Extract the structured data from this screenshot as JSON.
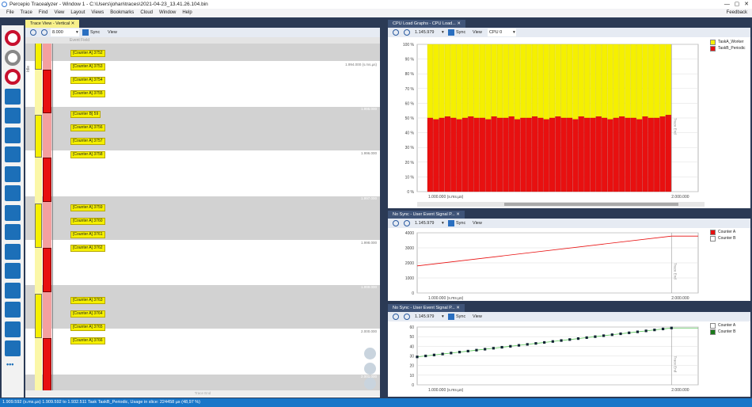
{
  "window": {
    "title": "Percepio Tracealyzer - Window 1 - C:\\Users\\johan\\traces\\2021-04-23_13.41.26.104.bin",
    "feedback": "Feedback"
  },
  "menu": [
    "File",
    "Trace",
    "Find",
    "View",
    "Layout",
    "Views",
    "Bookmarks",
    "Cloud",
    "Window",
    "Help"
  ],
  "sidebar": {
    "items": [
      "record",
      "stop",
      "snapshot",
      "overview",
      "trace",
      "cpu",
      "events",
      "actor",
      "kernel",
      "comm",
      "events-list",
      "signal",
      "flow",
      "memory",
      "user",
      "cpu-2",
      "cpu-3"
    ],
    "more": "•••"
  },
  "trace_view": {
    "tab": "Trace View - Vertical",
    "zoom": "8.000",
    "sync": "Sync",
    "view": "View",
    "event_field": "Event Field",
    "time_labels": [
      "1.994.000 (s.ms.µs)",
      "1.995.000",
      "1.996.000",
      "1.997.000",
      "1.998.000",
      "1.999.000",
      "2.000.000",
      "2.001.000"
    ],
    "events": [
      "[Counter A] 3752",
      "[Counter A] 3753",
      "[Counter A] 3754",
      "[Counter A] 3755",
      "[Counter B] 59",
      "[Counter A] 3756",
      "[Counter A] 3757",
      "[Counter A] 3758",
      "[Counter A] 3759",
      "[Counter A] 3760",
      "[Counter A] 3761",
      "[Counter A] 3762",
      "[Counter A] 3763",
      "[Counter A] 3764",
      "[Counter A] 3765",
      "[Counter A] 3766"
    ],
    "trace_end": "Trace End",
    "idle": "Idle"
  },
  "cpu_panel": {
    "tab": "CPU Load Graphs - CPU Load...",
    "zoom": "1.145.979",
    "sync": "Sync",
    "view": "View",
    "cpu": "CPU 0",
    "trace_end": "Trace End"
  },
  "signal_panel_1": {
    "tab": "No Sync - User Event Signal P...",
    "zoom": "1.145.979",
    "sync": "Sync",
    "view": "View",
    "trace_end": "Trace End"
  },
  "signal_panel_2": {
    "tab": "No Sync - User Event Signal P...",
    "zoom": "1.145.979",
    "sync": "Sync",
    "view": "View",
    "trace_end": "Trace End"
  },
  "status": "1.909.592 (s.ms.µs)   1.909.592 to 1.932.511 Task TaskB_Periodic, Usage in slice: 224458 µs (48,97 %)",
  "chart_data": [
    {
      "type": "bar",
      "title": "CPU Load",
      "stacked": true,
      "ylim": [
        0,
        100
      ],
      "yticks": [
        "0 %",
        "10 %",
        "20 %",
        "30 %",
        "40 %",
        "50 %",
        "60 %",
        "70 %",
        "80 %",
        "90 %",
        "100 %"
      ],
      "xticks": [
        "1.000.000 (s.ms.µs)",
        "2.000.000"
      ],
      "series": [
        {
          "name": "TaskA_Worker",
          "color": "#f5f000"
        },
        {
          "name": "TaskB_Periodic",
          "color": "#e81010",
          "values": [
            50,
            49,
            50,
            51,
            50,
            49,
            50,
            51,
            50,
            50,
            49,
            51,
            50,
            50,
            51,
            49,
            50,
            50,
            51,
            50,
            49,
            50,
            51,
            50,
            50,
            49,
            51,
            50,
            50,
            51,
            50,
            49,
            50,
            51,
            50,
            50,
            49,
            51,
            50,
            50,
            51,
            52
          ]
        }
      ]
    },
    {
      "type": "line",
      "ylim": [
        0,
        4000
      ],
      "yticks": [
        "0",
        "1000",
        "2000",
        "3000",
        "4000"
      ],
      "xticks": [
        "1.000.000 (s.ms.µs)",
        "2.000.000"
      ],
      "series": [
        {
          "name": "Counter A",
          "color": "#e81010",
          "x": [
            0,
            1
          ],
          "values": [
            1800,
            3780
          ]
        },
        {
          "name": "Counter B",
          "color": "#ffffff",
          "values": []
        }
      ]
    },
    {
      "type": "line",
      "ylim": [
        0,
        60
      ],
      "yticks": [
        "0",
        "10",
        "20",
        "30",
        "40",
        "50",
        "60"
      ],
      "xticks": [
        "1.000.000 (s.ms.µs)",
        "2.000.000"
      ],
      "series": [
        {
          "name": "Counter A",
          "color": "#ffffff",
          "values": []
        },
        {
          "name": "Counter B",
          "color": "#1a7a1a",
          "values": [
            29,
            30,
            31,
            32,
            33,
            34,
            35,
            36,
            37,
            38,
            39,
            40,
            41,
            42,
            43,
            44,
            45,
            46,
            47,
            48,
            49,
            50,
            51,
            52,
            53,
            54,
            55,
            56,
            57,
            58,
            59
          ]
        }
      ]
    }
  ]
}
